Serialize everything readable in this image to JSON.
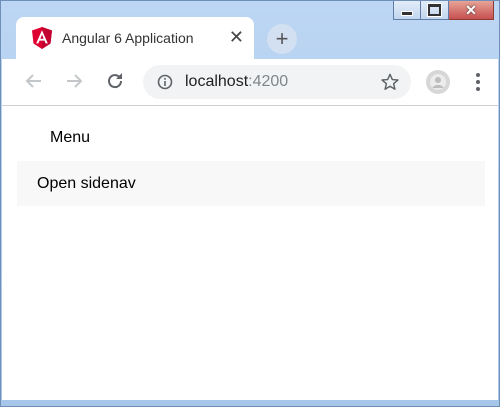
{
  "window": {
    "controls": {
      "minimize": "minimize",
      "maximize": "maximize",
      "close": "close"
    }
  },
  "tab": {
    "title": "Angular 6 Application",
    "icon": "angular-icon",
    "close_glyph": "✕"
  },
  "toolbar": {
    "back_icon": "arrow-left-icon",
    "forward_icon": "arrow-right-icon",
    "reload_icon": "reload-icon",
    "url_host": "localhost",
    "url_port": ":4200",
    "bookmark_icon": "star-icon",
    "profile_icon": "profile-icon",
    "menu_icon": "kebab-menu-icon",
    "new_tab_glyph": "+"
  },
  "page": {
    "menu_label": "Menu",
    "sidenav_link": "Open sidenav"
  },
  "colors": {
    "angular_red": "#dd0031",
    "frame_blue": "#a9c8ea",
    "window_close_red": "#c75050"
  }
}
